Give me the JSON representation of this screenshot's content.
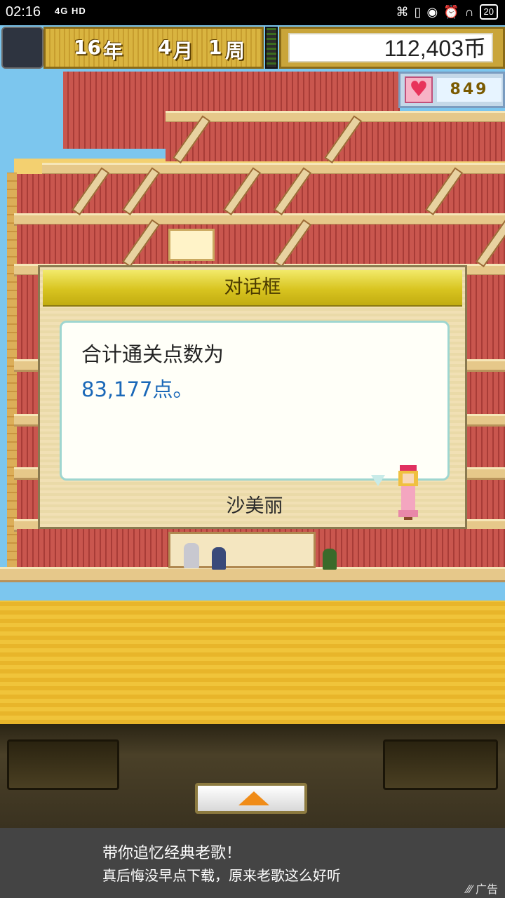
{
  "status_bar": {
    "time": "02:16",
    "network": "4G HD",
    "battery": "20"
  },
  "hud": {
    "date": {
      "year": "16",
      "year_unit": "年",
      "month": "4",
      "month_unit": "月",
      "week": "1",
      "week_unit": "周"
    },
    "money": "112,403币",
    "hearts": "849"
  },
  "dialog": {
    "title": "对话框",
    "line1": "合计通关点数为",
    "line2": "83,177点。",
    "speaker": "沙美丽"
  },
  "ad": {
    "line1": "带你追忆经典老歌！",
    "line2": "真后悔没早点下载，原来老歌这么好听",
    "label": "广告"
  },
  "colors": {
    "dialog_header": "#d8c420",
    "points_text": "#1a68b8",
    "up_arrow": "#f08c18",
    "heart": "#e8325a"
  }
}
